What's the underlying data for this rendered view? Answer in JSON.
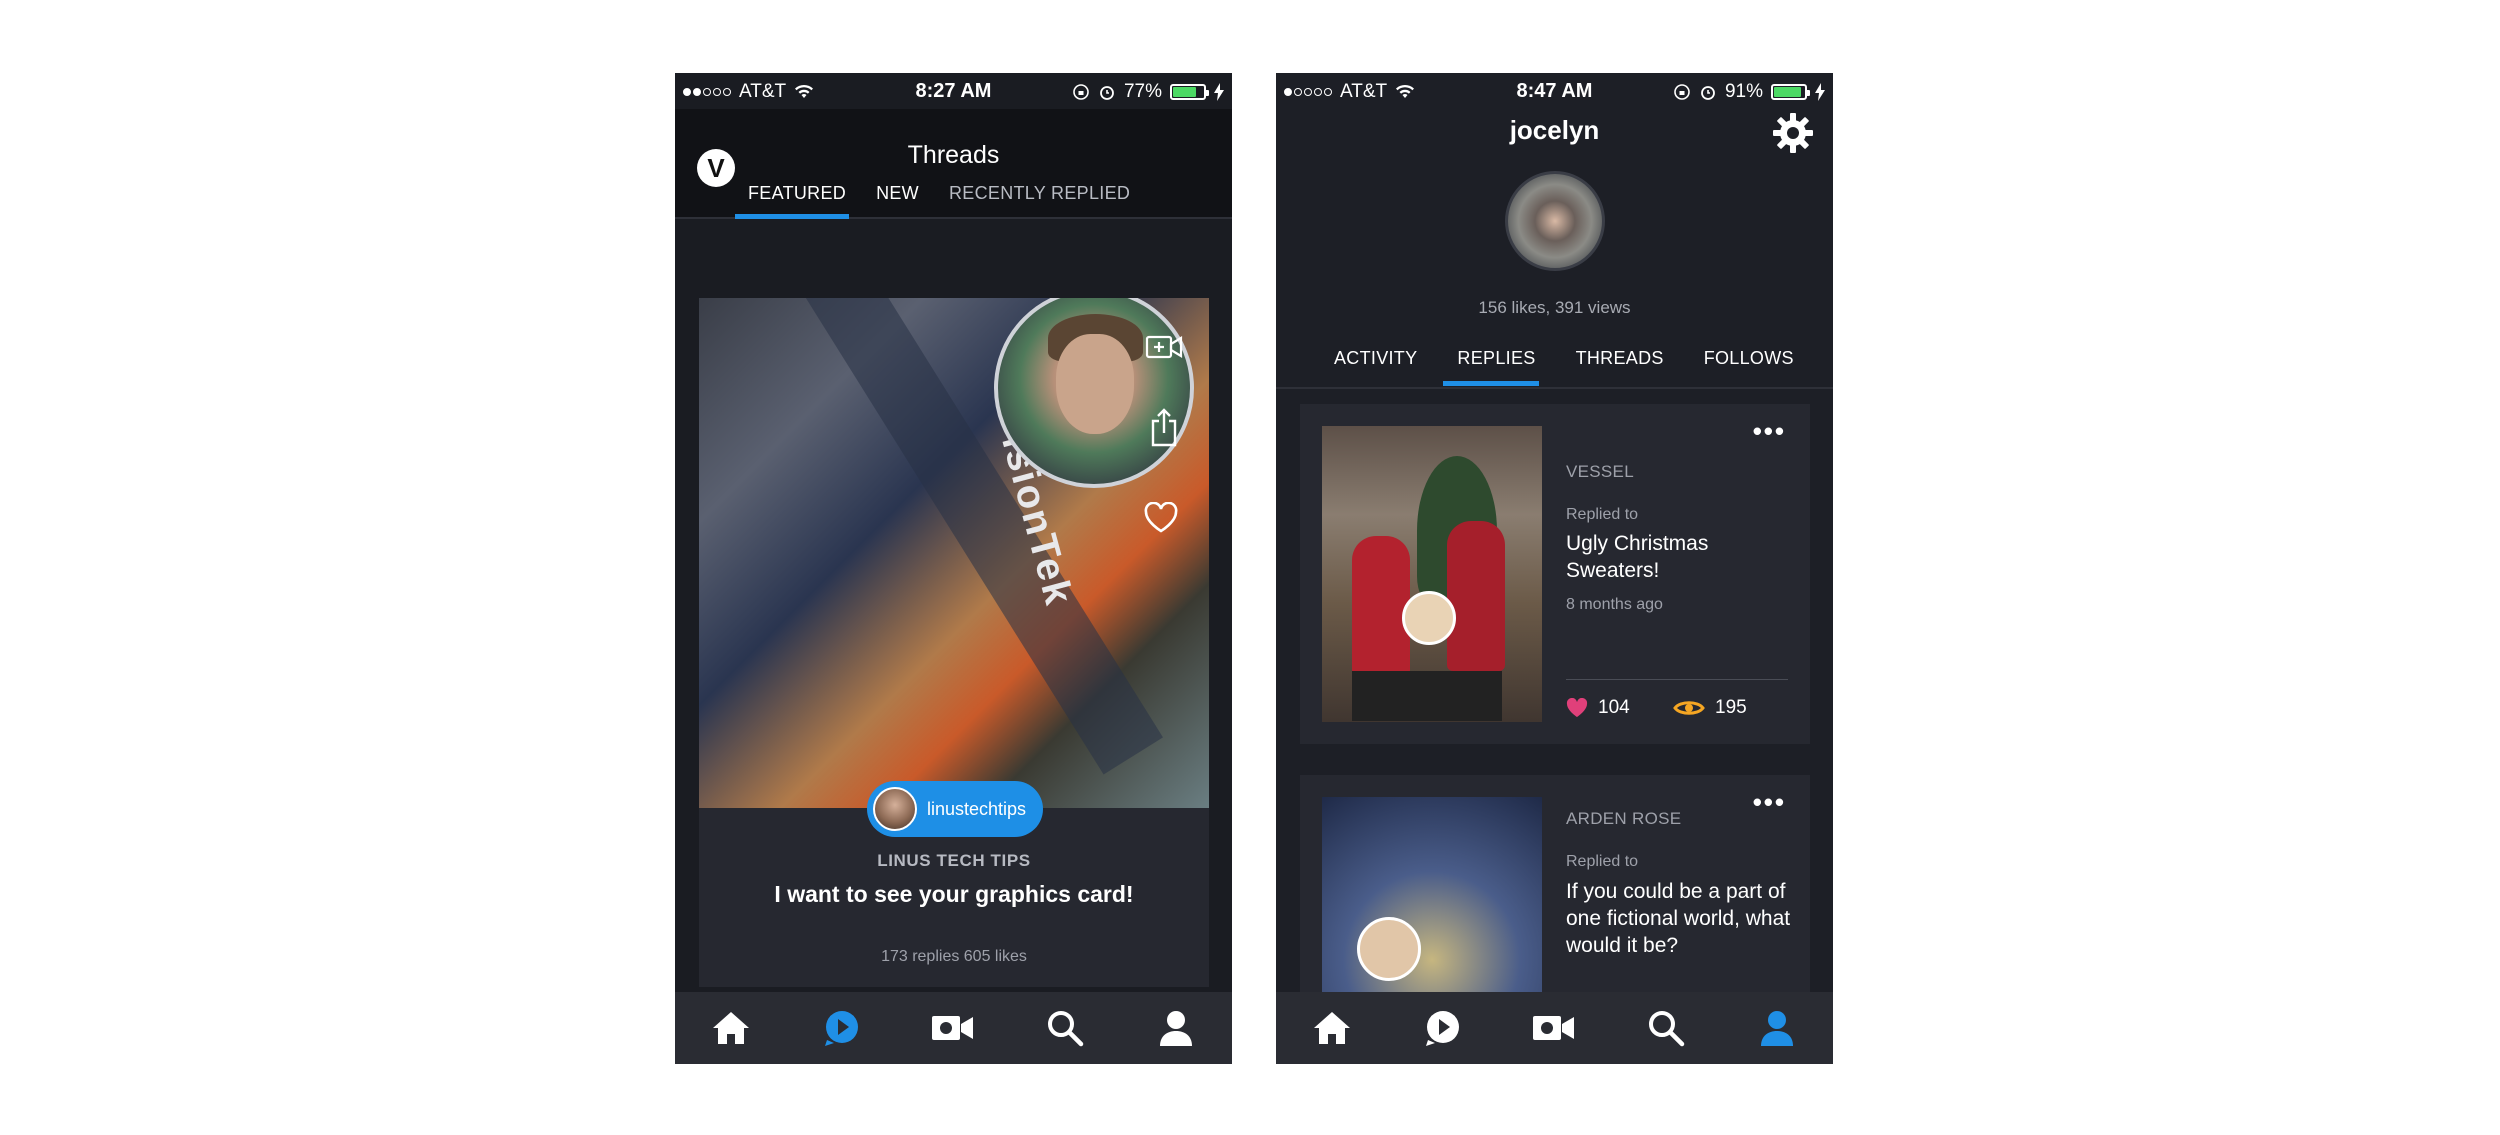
{
  "left_phone": {
    "status": {
      "carrier": "AT&T",
      "time": "8:27 AM",
      "battery": "77%",
      "battery_level": 0.77
    },
    "header": {
      "title": "Threads",
      "logo": "V"
    },
    "tabs": [
      {
        "label": "FEATURED",
        "active": true
      },
      {
        "label": "NEW",
        "active": false
      },
      {
        "label": "RECENTLY REPLIED",
        "active": false
      }
    ],
    "card": {
      "user_chip": "linustechtips",
      "channel": "LINUS TECH TIPS",
      "title": "I want to see your graphics card!",
      "stats": "173 replies  605 likes",
      "icons": [
        "camera-add-icon",
        "share-icon",
        "heart-icon"
      ]
    },
    "nav": [
      "home-icon",
      "threads-icon",
      "camera-icon",
      "search-icon",
      "profile-icon"
    ],
    "nav_active": "threads-icon"
  },
  "right_phone": {
    "status": {
      "carrier": "AT&T",
      "time": "8:47 AM",
      "battery": "91%",
      "battery_level": 0.91
    },
    "profile": {
      "username": "jocelyn",
      "stats": "156 likes, 391 views"
    },
    "tabs": [
      {
        "label": "ACTIVITY",
        "active": false
      },
      {
        "label": "REPLIES",
        "active": true
      },
      {
        "label": "THREADS",
        "active": false
      },
      {
        "label": "FOLLOWS",
        "active": false
      }
    ],
    "replies": [
      {
        "source": "VESSEL",
        "replied_label": "Replied to",
        "title": "Ugly Christmas Sweaters!",
        "ago": "8 months ago",
        "likes": "104",
        "views": "195"
      },
      {
        "source": "ARDEN ROSE",
        "replied_label": "Replied to",
        "title": "If you could be a part of one fictional world, what would it be?"
      }
    ],
    "more_label": "•••",
    "nav": [
      "home-icon",
      "threads-icon",
      "camera-icon",
      "search-icon",
      "profile-icon"
    ],
    "nav_active": "profile-icon"
  },
  "colors": {
    "accent": "#1f8fe6",
    "like": "#e0407a",
    "views": "#f5a623",
    "battery_fill": "#4cd964"
  }
}
